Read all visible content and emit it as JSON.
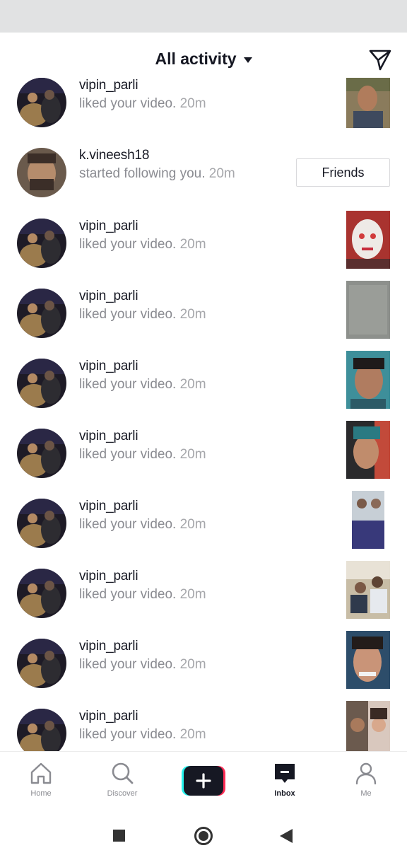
{
  "header": {
    "title": "All activity",
    "caret_icon": "caret-down-icon",
    "send_icon": "paper-plane-icon"
  },
  "notifications": [
    {
      "username": "vipin_parli",
      "action": "liked your video.",
      "time": "20m"
    },
    {
      "username": "k.vineesh18",
      "action": "started following you.",
      "time": "20m",
      "button": "Friends"
    },
    {
      "username": "vipin_parli",
      "action": "liked your video.",
      "time": "20m"
    },
    {
      "username": "vipin_parli",
      "action": "liked your video.",
      "time": "20m"
    },
    {
      "username": "vipin_parli",
      "action": "liked your video.",
      "time": "20m"
    },
    {
      "username": "vipin_parli",
      "action": "liked your video.",
      "time": "20m"
    },
    {
      "username": "vipin_parli",
      "action": "liked your video.",
      "time": "20m"
    },
    {
      "username": "vipin_parli",
      "action": "liked your video.",
      "time": "20m"
    },
    {
      "username": "vipin_parli",
      "action": "liked your video.",
      "time": "20m"
    },
    {
      "username": "vipin_parli",
      "action": "liked your video.",
      "time": "20m"
    }
  ],
  "tabbar": {
    "home": "Home",
    "discover": "Discover",
    "inbox": "Inbox",
    "me": "Me",
    "active": "Inbox"
  },
  "colors": {
    "accent_cyan": "#25f4ee",
    "accent_red": "#fe2c55",
    "text_primary": "#161823",
    "text_secondary": "#8a8b91"
  }
}
